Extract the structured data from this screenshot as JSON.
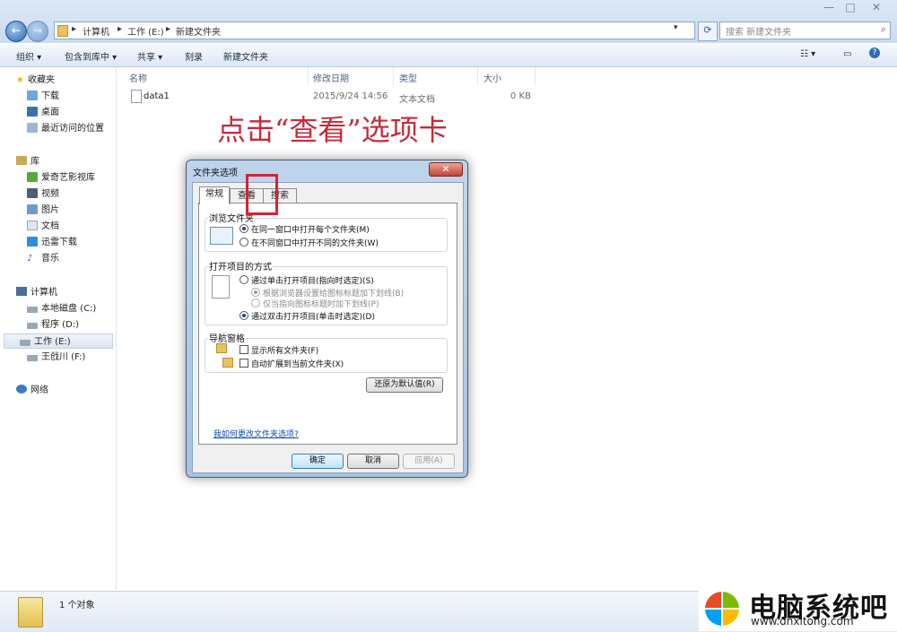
{
  "window": {
    "minimize": "—",
    "maximize": "□",
    "close": "✕"
  },
  "address": {
    "segments": [
      "计算机",
      "工作 (E:)",
      "新建文件夹"
    ],
    "sep": "▸"
  },
  "search": {
    "placeholder": "搜索 新建文件夹"
  },
  "toolbar": {
    "organize": "组织 ▾",
    "include": "包含到库中 ▾",
    "share": "共享 ▾",
    "burn": "刻录",
    "new_folder": "新建文件夹"
  },
  "nav": {
    "favorites": "收藏夹",
    "fav_items": [
      "下载",
      "桌面",
      "最近访问的位置"
    ],
    "libraries": "库",
    "lib_items": [
      "爱奇艺影视库",
      "视频",
      "图片",
      "文档",
      "迅雷下载",
      "音乐"
    ],
    "computer": "计算机",
    "drives": [
      "本地磁盘 (C:)",
      "程序 (D:)",
      "工作 (E:)",
      "王戗川 (F:)"
    ],
    "network": "网络"
  },
  "list": {
    "columns": [
      "名称",
      "修改日期",
      "类型",
      "大小"
    ],
    "rows": [
      {
        "name": "data1",
        "date": "2015/9/24 14:56",
        "type": "文本文档",
        "size": "0 KB"
      }
    ]
  },
  "caption": "点击“查看”选项卡",
  "dialog": {
    "title": "文件夹选项",
    "close": "✕",
    "tabs": [
      "常规",
      "查看",
      "搜索"
    ],
    "browse_group": "浏览文件夹",
    "browse_opts": [
      "在同一窗口中打开每个文件夹(M)",
      "在不同窗口中打开不同的文件夹(W)"
    ],
    "open_group": "打开项目的方式",
    "open_opts": [
      "通过单击打开项目(指向时选定)(S)",
      "根据浏览器设置给图标标题加下划线(B)",
      "仅当指向图标标题时加下划线(P)",
      "通过双击打开项目(单击时选定)(D)"
    ],
    "nav_group": "导航窗格",
    "nav_opts": [
      "显示所有文件夹(F)",
      "自动扩展到当前文件夹(X)"
    ],
    "restore": "还原为默认值(R)",
    "help": "我如何更改文件夹选项?",
    "ok": "确定",
    "cancel": "取消",
    "apply": "应用(A)"
  },
  "status": {
    "text": "1 个对象"
  },
  "watermark": {
    "title": "电脑系统吧",
    "url": "www.dnxitong.com"
  },
  "colors": {
    "highlight": "#d0243b",
    "caption": "#c52b3c",
    "accent": "#2f6cb5"
  }
}
